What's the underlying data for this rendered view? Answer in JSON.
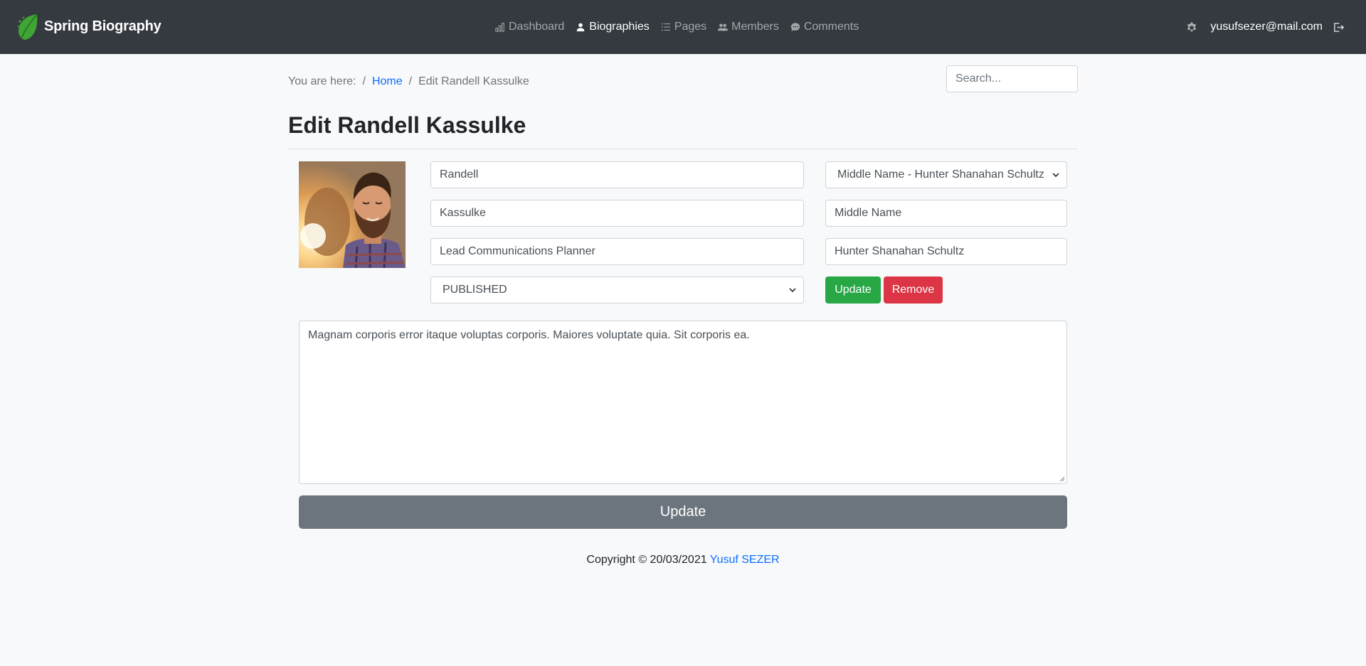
{
  "nav": {
    "brand": "Spring Biography",
    "items": [
      {
        "label": "Dashboard",
        "icon": "bar-chart-icon"
      },
      {
        "label": "Biographies",
        "icon": "person-icon"
      },
      {
        "label": "Pages",
        "icon": "list-icon"
      },
      {
        "label": "Members",
        "icon": "people-icon"
      },
      {
        "label": "Comments",
        "icon": "chat-icon"
      }
    ],
    "active_item": "Biographies",
    "user_email": "yusufsezer@mail.com"
  },
  "breadcrumb": {
    "prefix": "You are here:",
    "separator": "/",
    "home": "Home",
    "current": "Edit Randell Kassulke"
  },
  "search": {
    "placeholder": "Search..."
  },
  "page": {
    "title": "Edit Randell Kassulke"
  },
  "form": {
    "first_name": "Randell",
    "last_name": "Kassulke",
    "job_title": "Lead Communications Planner",
    "status": "PUBLISHED",
    "middle_name_select": "Middle Name - Hunter Shanahan Schultz",
    "middle_name_label": "Middle Name",
    "middle_name_value": "Hunter Shanahan Schultz",
    "update_label": "Update",
    "remove_label": "Remove",
    "biography_text": "Magnam corporis error itaque voluptas corporis. Maiores voluptate quia. Sit corporis ea.",
    "submit_label": "Update"
  },
  "footer": {
    "copyright": "Copyright © 20/03/2021",
    "author": "Yusuf SEZER"
  },
  "colors": {
    "navbar": "#343a40",
    "success": "#28a745",
    "danger": "#dc3545",
    "secondary": "#6c757d",
    "link": "#0d6efd"
  }
}
